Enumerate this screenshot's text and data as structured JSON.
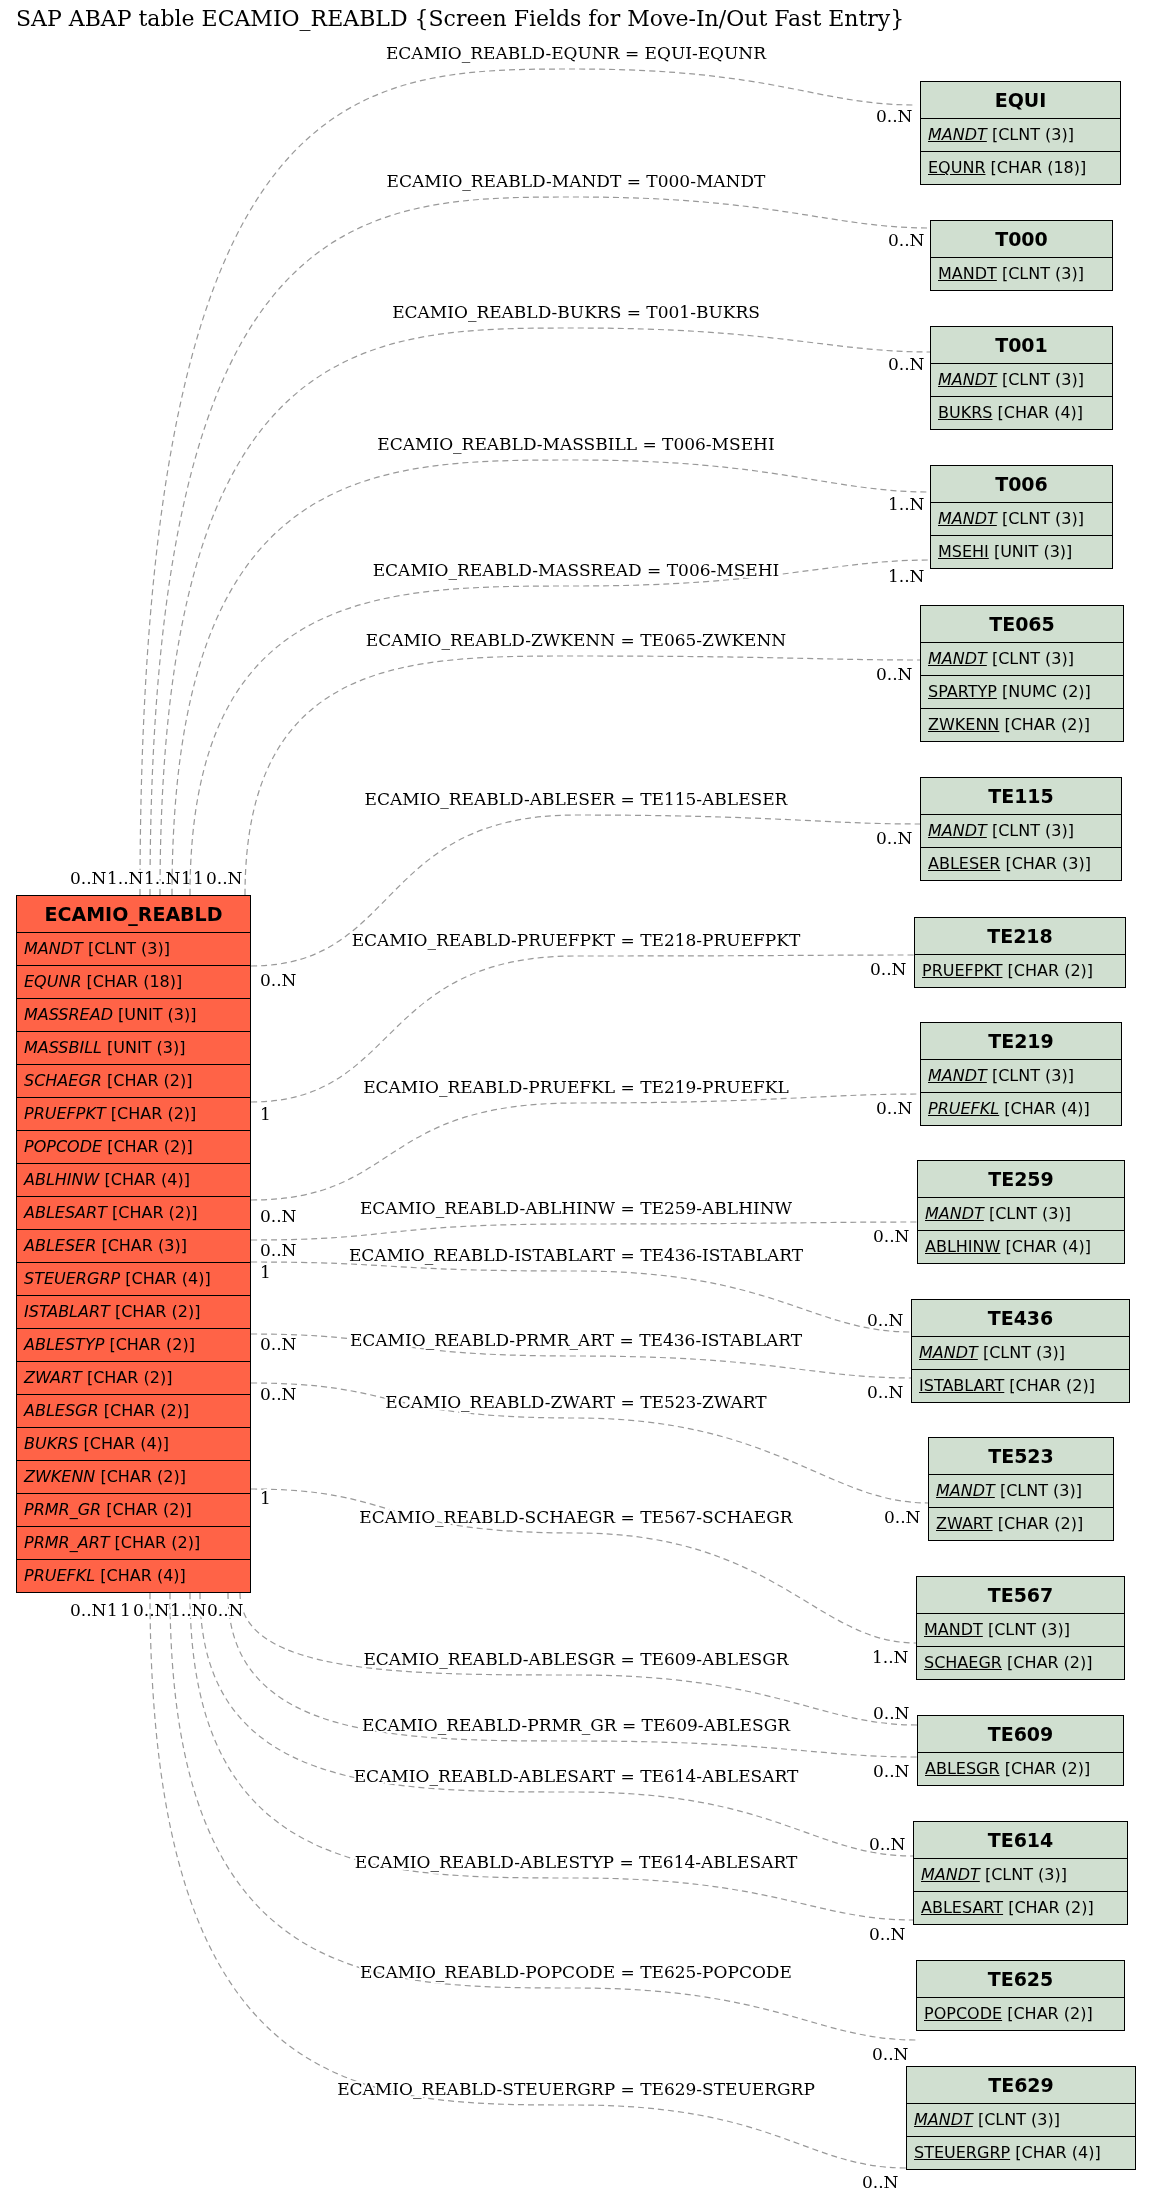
{
  "title": "SAP ABAP table ECAMIO_REABLD {Screen Fields for Move-In/Out Fast Entry}",
  "tables": [
    {
      "kind": "main",
      "name": "ECAMIO_REABLD",
      "fields": [
        {
          "name": "MANDT",
          "type": "[CLNT (3)]",
          "italic": true,
          "key": false
        },
        {
          "name": "EQUNR",
          "type": "[CHAR (18)]",
          "italic": true,
          "key": false
        },
        {
          "name": "MASSREAD",
          "type": "[UNIT (3)]",
          "italic": true,
          "key": false
        },
        {
          "name": "MASSBILL",
          "type": "[UNIT (3)]",
          "italic": true,
          "key": false
        },
        {
          "name": "SCHAEGR",
          "type": "[CHAR (2)]",
          "italic": true,
          "key": false
        },
        {
          "name": "PRUEFPKT",
          "type": "[CHAR (2)]",
          "italic": true,
          "key": false
        },
        {
          "name": "POPCODE",
          "type": "[CHAR (2)]",
          "italic": true,
          "key": false
        },
        {
          "name": "ABLHINW",
          "type": "[CHAR (4)]",
          "italic": true,
          "key": false
        },
        {
          "name": "ABLESART",
          "type": "[CHAR (2)]",
          "italic": true,
          "key": false
        },
        {
          "name": "ABLESER",
          "type": "[CHAR (3)]",
          "italic": true,
          "key": false
        },
        {
          "name": "STEUERGRP",
          "type": "[CHAR (4)]",
          "italic": true,
          "key": false
        },
        {
          "name": "ISTABLART",
          "type": "[CHAR (2)]",
          "italic": true,
          "key": false
        },
        {
          "name": "ABLESTYP",
          "type": "[CHAR (2)]",
          "italic": true,
          "key": false
        },
        {
          "name": "ZWART",
          "type": "[CHAR (2)]",
          "italic": true,
          "key": false
        },
        {
          "name": "ABLESGR",
          "type": "[CHAR (2)]",
          "italic": true,
          "key": false
        },
        {
          "name": "BUKRS",
          "type": "[CHAR (4)]",
          "italic": true,
          "key": false
        },
        {
          "name": "ZWKENN",
          "type": "[CHAR (2)]",
          "italic": true,
          "key": false
        },
        {
          "name": "PRMR_GR",
          "type": "[CHAR (2)]",
          "italic": true,
          "key": false
        },
        {
          "name": "PRMR_ART",
          "type": "[CHAR (2)]",
          "italic": true,
          "key": false
        },
        {
          "name": "PRUEFKL",
          "type": "[CHAR (4)]",
          "italic": true,
          "key": false
        }
      ]
    },
    {
      "kind": "related",
      "name": "EQUI",
      "fields": [
        {
          "name": "MANDT",
          "type": "[CLNT (3)]",
          "italic": true,
          "key": true
        },
        {
          "name": "EQUNR",
          "type": "[CHAR (18)]",
          "italic": false,
          "key": true
        }
      ]
    },
    {
      "kind": "related",
      "name": "T000",
      "fields": [
        {
          "name": "MANDT",
          "type": "[CLNT (3)]",
          "italic": false,
          "key": true
        }
      ]
    },
    {
      "kind": "related",
      "name": "T001",
      "fields": [
        {
          "name": "MANDT",
          "type": "[CLNT (3)]",
          "italic": true,
          "key": true
        },
        {
          "name": "BUKRS",
          "type": "[CHAR (4)]",
          "italic": false,
          "key": true
        }
      ]
    },
    {
      "kind": "related",
      "name": "T006",
      "fields": [
        {
          "name": "MANDT",
          "type": "[CLNT (3)]",
          "italic": true,
          "key": true
        },
        {
          "name": "MSEHI",
          "type": "[UNIT (3)]",
          "italic": false,
          "key": true
        }
      ]
    },
    {
      "kind": "related",
      "name": "TE065",
      "fields": [
        {
          "name": "MANDT",
          "type": "[CLNT (3)]",
          "italic": true,
          "key": true
        },
        {
          "name": "SPARTYP",
          "type": "[NUMC (2)]",
          "italic": false,
          "key": true
        },
        {
          "name": "ZWKENN",
          "type": "[CHAR (2)]",
          "italic": false,
          "key": true
        }
      ]
    },
    {
      "kind": "related",
      "name": "TE115",
      "fields": [
        {
          "name": "MANDT",
          "type": "[CLNT (3)]",
          "italic": true,
          "key": true
        },
        {
          "name": "ABLESER",
          "type": "[CHAR (3)]",
          "italic": false,
          "key": true
        }
      ]
    },
    {
      "kind": "related",
      "name": "TE218",
      "fields": [
        {
          "name": "PRUEFPKT",
          "type": "[CHAR (2)]",
          "italic": false,
          "key": true
        }
      ]
    },
    {
      "kind": "related",
      "name": "TE219",
      "fields": [
        {
          "name": "MANDT",
          "type": "[CLNT (3)]",
          "italic": true,
          "key": true
        },
        {
          "name": "PRUEFKL",
          "type": "[CHAR (4)]",
          "italic": true,
          "key": true
        }
      ]
    },
    {
      "kind": "related",
      "name": "TE259",
      "fields": [
        {
          "name": "MANDT",
          "type": "[CLNT (3)]",
          "italic": true,
          "key": true
        },
        {
          "name": "ABLHINW",
          "type": "[CHAR (4)]",
          "italic": false,
          "key": true
        }
      ]
    },
    {
      "kind": "related",
      "name": "TE436",
      "fields": [
        {
          "name": "MANDT",
          "type": "[CLNT (3)]",
          "italic": true,
          "key": true
        },
        {
          "name": "ISTABLART",
          "type": "[CHAR (2)]",
          "italic": false,
          "key": true
        }
      ]
    },
    {
      "kind": "related",
      "name": "TE523",
      "fields": [
        {
          "name": "MANDT",
          "type": "[CLNT (3)]",
          "italic": true,
          "key": true
        },
        {
          "name": "ZWART",
          "type": "[CHAR (2)]",
          "italic": false,
          "key": true
        }
      ]
    },
    {
      "kind": "related",
      "name": "TE567",
      "fields": [
        {
          "name": "MANDT",
          "type": "[CLNT (3)]",
          "italic": false,
          "key": true
        },
        {
          "name": "SCHAEGR",
          "type": "[CHAR (2)]",
          "italic": false,
          "key": true
        }
      ]
    },
    {
      "kind": "related",
      "name": "TE609",
      "fields": [
        {
          "name": "ABLESGR",
          "type": "[CHAR (2)]",
          "italic": false,
          "key": true
        }
      ]
    },
    {
      "kind": "related",
      "name": "TE614",
      "fields": [
        {
          "name": "MANDT",
          "type": "[CLNT (3)]",
          "italic": true,
          "key": true
        },
        {
          "name": "ABLESART",
          "type": "[CHAR (2)]",
          "italic": false,
          "key": true
        }
      ]
    },
    {
      "kind": "related",
      "name": "TE625",
      "fields": [
        {
          "name": "POPCODE",
          "type": "[CHAR (2)]",
          "italic": false,
          "key": true
        }
      ]
    },
    {
      "kind": "related",
      "name": "TE629",
      "fields": [
        {
          "name": "MANDT",
          "type": "[CLNT (3)]",
          "italic": true,
          "key": true
        },
        {
          "name": "STEUERGRP",
          "type": "[CHAR (4)]",
          "italic": false,
          "key": true
        }
      ]
    }
  ],
  "relations": [
    {
      "label": "ECAMIO_REABLD-EQUNR = EQUI-EQUNR",
      "from_card": "0..N",
      "to_card": "0..N"
    },
    {
      "label": "ECAMIO_REABLD-MANDT = T000-MANDT",
      "from_card": "1..N",
      "to_card": "0..N"
    },
    {
      "label": "ECAMIO_REABLD-BUKRS = T001-BUKRS",
      "from_card": "1..N",
      "to_card": "0..N"
    },
    {
      "label": "ECAMIO_REABLD-MASSBILL = T006-MSEHI",
      "from_card": "1",
      "to_card": "1..N"
    },
    {
      "label": "ECAMIO_REABLD-MASSREAD = T006-MSEHI",
      "from_card": "1",
      "to_card": "1..N"
    },
    {
      "label": "ECAMIO_REABLD-ZWKENN = TE065-ZWKENN",
      "from_card": "0..N",
      "to_card": "0..N"
    },
    {
      "label": "ECAMIO_REABLD-ABLESER = TE115-ABLESER",
      "from_card": "0..N",
      "to_card": "0..N"
    },
    {
      "label": "ECAMIO_REABLD-PRUEFPKT = TE218-PRUEFPKT",
      "from_card": "1",
      "to_card": "0..N"
    },
    {
      "label": "ECAMIO_REABLD-PRUEFKL = TE219-PRUEFKL",
      "from_card": "0..N",
      "to_card": "0..N"
    },
    {
      "label": "ECAMIO_REABLD-ABLHINW = TE259-ABLHINW",
      "from_card": "0..N",
      "to_card": "0..N"
    },
    {
      "label": "ECAMIO_REABLD-ISTABLART = TE436-ISTABLART",
      "from_card": "1",
      "to_card": "0..N"
    },
    {
      "label": "ECAMIO_REABLD-PRMR_ART = TE436-ISTABLART",
      "from_card": "0..N",
      "to_card": "0..N"
    },
    {
      "label": "ECAMIO_REABLD-ZWART = TE523-ZWART",
      "from_card": "0..N",
      "to_card": "0..N"
    },
    {
      "label": "ECAMIO_REABLD-SCHAEGR = TE567-SCHAEGR",
      "from_card": "1",
      "to_card": "1..N"
    },
    {
      "label": "ECAMIO_REABLD-ABLESGR = TE609-ABLESGR",
      "from_card": "0..N",
      "to_card": "0..N"
    },
    {
      "label": "ECAMIO_REABLD-PRMR_GR = TE609-ABLESGR",
      "from_card": "1",
      "to_card": "0..N"
    },
    {
      "label": "ECAMIO_REABLD-ABLESART = TE614-ABLESART",
      "from_card": "1",
      "to_card": "0..N"
    },
    {
      "label": "ECAMIO_REABLD-ABLESTYP = TE614-ABLESART",
      "from_card": "0..N",
      "to_card": "0..N"
    },
    {
      "label": "ECAMIO_REABLD-POPCODE = TE625-POPCODE",
      "from_card": "1..N",
      "to_card": "0..N"
    },
    {
      "label": "ECAMIO_REABLD-STEUERGRP = TE629-STEUERGRP",
      "from_card": "0..N",
      "to_card": "0..N"
    }
  ]
}
